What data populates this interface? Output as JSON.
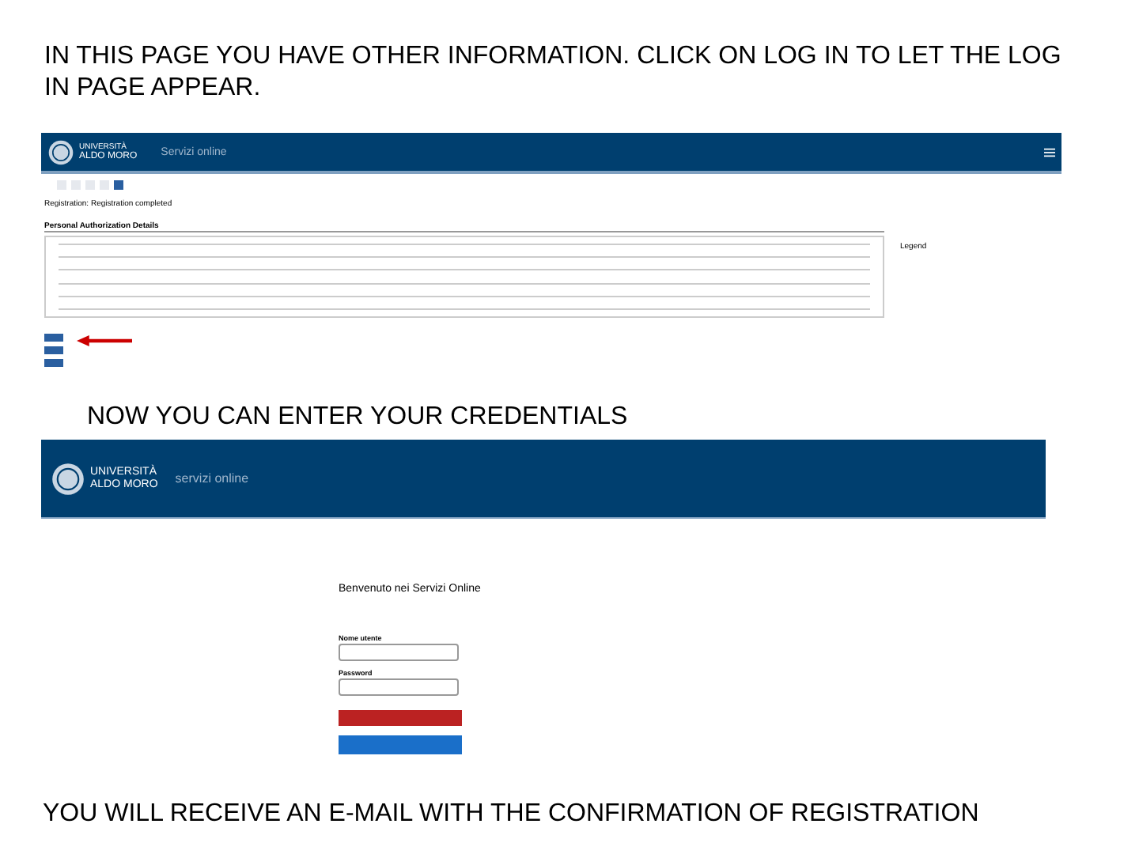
{
  "captions": [
    "IN THIS PAGE YOU HAVE OTHER INFORMATION. CLICK ON LOG IN TO LET THE LOG IN PAGE APPEAR.",
    "NOW YOU CAN ENTER YOUR CREDENTIALS",
    "YOU WILL RECEIVE AN E-MAIL WITH THE CONFIRMATION OF REGISTRATION"
  ],
  "registration_page": {
    "logo": {
      "top": "UNIVERSITÀ",
      "bottom": "ALDO MORO"
    },
    "service": "Servizi online",
    "steps": [
      {
        "selected": false
      },
      {
        "selected": false
      },
      {
        "selected": false
      },
      {
        "selected": false
      },
      {
        "selected": true
      }
    ],
    "title": "Registration: Registration completed",
    "section": "Personal Authorization Details",
    "side_title": "Legend"
  },
  "login_page": {
    "logo": {
      "top": "UNIVERSITÀ",
      "bottom": "ALDO MORO"
    },
    "service": "servizi online",
    "title": "Benvenuto nei Servizi Online",
    "fields": [
      {
        "label": "Nome utente"
      },
      {
        "label": "Password"
      }
    ]
  }
}
